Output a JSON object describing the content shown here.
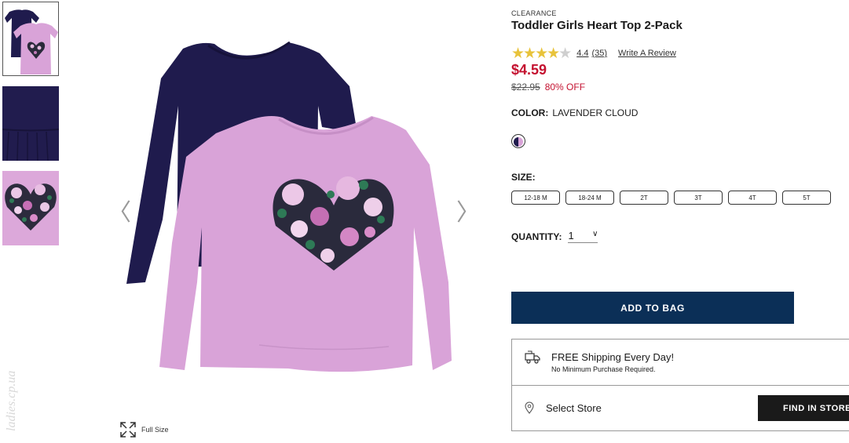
{
  "gallery": {
    "thumbnails": [
      "thumb-2pack",
      "thumb-navy-detail",
      "thumb-heart-detail"
    ],
    "selected_index": 0,
    "full_size_label": "Full Size",
    "watermark": "ladies.cp.ua"
  },
  "product": {
    "eyebrow": "CLEARANCE",
    "title": "Toddler Girls Heart Top 2-Pack",
    "rating_value": 4.4,
    "rating_display": "4.4",
    "review_count": "(35)",
    "write_review": "Write A Review",
    "price": "$4.59",
    "original_price": "$22.95",
    "discount": "80% OFF",
    "color_label": "COLOR:",
    "color_value": "LAVENDER CLOUD",
    "size_label": "SIZE:",
    "sizes": [
      "12-18 M",
      "18-24 M",
      "2T",
      "3T",
      "4T",
      "5T"
    ],
    "quantity_label": "QUANTITY:",
    "quantity_value": "1",
    "add_to_bag": "ADD TO BAG"
  },
  "shipping": {
    "title": "FREE Shipping Every Day!",
    "subtitle": "No Minimum Purchase Required.",
    "store_label": "Select Store",
    "find_button": "FIND IN STORE"
  },
  "colors": {
    "price_red": "#c41230",
    "cta_navy": "#0b2f57",
    "star_gold": "#e8c33b",
    "shirt_navy": "#1f1b4d",
    "shirt_lavender": "#d9a3d8"
  }
}
